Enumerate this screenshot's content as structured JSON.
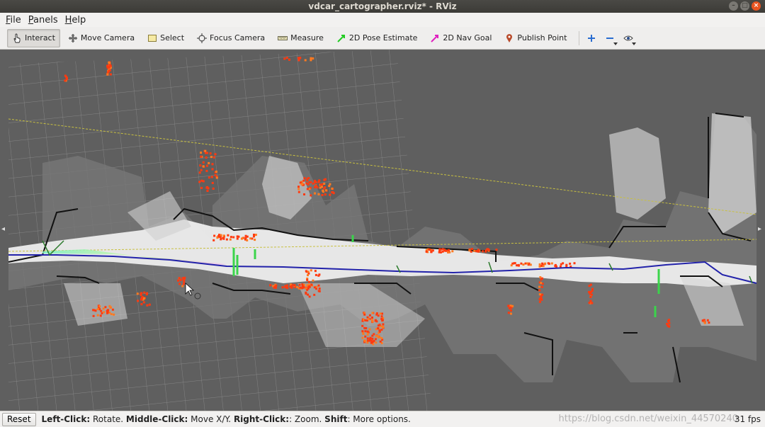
{
  "window": {
    "title": "vdcar_cartographer.rviz* - RViz"
  },
  "menu": {
    "file": "File",
    "panels": "Panels",
    "help": "Help"
  },
  "toolbar": {
    "interact": "Interact",
    "move_camera": "Move Camera",
    "select": "Select",
    "focus_camera": "Focus Camera",
    "measure": "Measure",
    "pose_estimate": "2D Pose Estimate",
    "nav_goal": "2D Nav Goal",
    "publish_point": "Publish Point"
  },
  "colors": {
    "pose_estimate": "#22cc22",
    "nav_goal": "#e020c0",
    "publish_point": "#b84a2a",
    "path": "#2222aa",
    "scan": "#ff3a10"
  },
  "status": {
    "reset": "Reset",
    "hint_parts": [
      {
        "b": "Left-Click:",
        "t": " Rotate. "
      },
      {
        "b": "Middle-Click:",
        "t": " Move X/Y. "
      },
      {
        "b": "Right-Click:",
        "t": ": Zoom. "
      },
      {
        "b": "Shift",
        "t": ": More options."
      }
    ],
    "watermark": "https://blog.csdn.net/weixin_44570240",
    "fps": "31 fps"
  }
}
